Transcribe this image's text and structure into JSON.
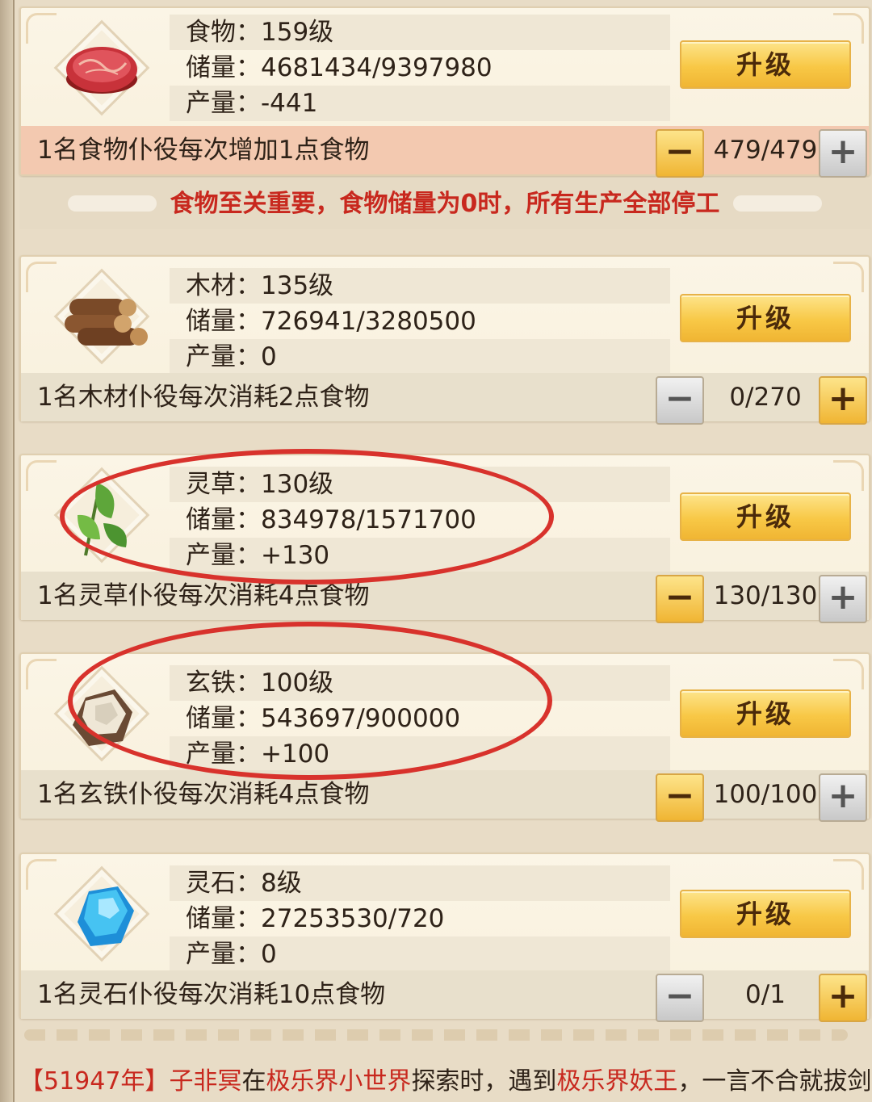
{
  "resources": [
    {
      "id": "food",
      "icon": "meat-icon",
      "name_line": "食物：159级",
      "storage_line": "储量：4681434/9397980",
      "output_line": "产量：-441",
      "upgrade_label": "升级",
      "desc": "1名食物仆役每次增加1点食物",
      "count": "479/479",
      "minus_style": "gold",
      "plus_style": "grey"
    },
    {
      "id": "wood",
      "icon": "wood-logs-icon",
      "name_line": "木材：135级",
      "storage_line": "储量：726941/3280500",
      "output_line": "产量：0",
      "upgrade_label": "升级",
      "desc": "1名木材仆役每次消耗2点食物",
      "count": "0/270",
      "minus_style": "grey",
      "plus_style": "gold"
    },
    {
      "id": "herb",
      "icon": "herb-leaf-icon",
      "name_line": "灵草：130级",
      "storage_line": "储量：834978/1571700",
      "output_line": "产量：+130",
      "upgrade_label": "升级",
      "desc": "1名灵草仆役每次消耗4点食物",
      "count": "130/130",
      "minus_style": "gold",
      "plus_style": "grey"
    },
    {
      "id": "iron",
      "icon": "iron-ore-icon",
      "name_line": "玄铁：100级",
      "storage_line": "储量：543697/900000",
      "output_line": "产量：+100",
      "upgrade_label": "升级",
      "desc": "1名玄铁仆役每次消耗4点食物",
      "count": "100/100",
      "minus_style": "gold",
      "plus_style": "grey"
    },
    {
      "id": "stone",
      "icon": "spirit-stone-icon",
      "name_line": "灵石：8级",
      "storage_line": "储量：27253530/720",
      "output_line": "产量：0",
      "upgrade_label": "升级",
      "desc": "1名灵石仆役每次消耗10点食物",
      "count": "0/1",
      "minus_style": "grey",
      "plus_style": "gold"
    }
  ],
  "step_symbols": {
    "minus": "−",
    "plus": "+"
  },
  "notice": "食物至关重要，食物储量为0时，所有生产全部停工",
  "log": {
    "year": "【51947年】",
    "actor": "子非冥",
    "t1": "在",
    "place": "极乐界小世界",
    "t2": "探索时，遇到",
    "enemy": "极乐界妖王",
    "t3": "，一言不合就拔剑"
  },
  "colors": {
    "accent_red": "#c8281e",
    "button_gold": "#f8c846",
    "annotation_red": "#d8322c"
  }
}
